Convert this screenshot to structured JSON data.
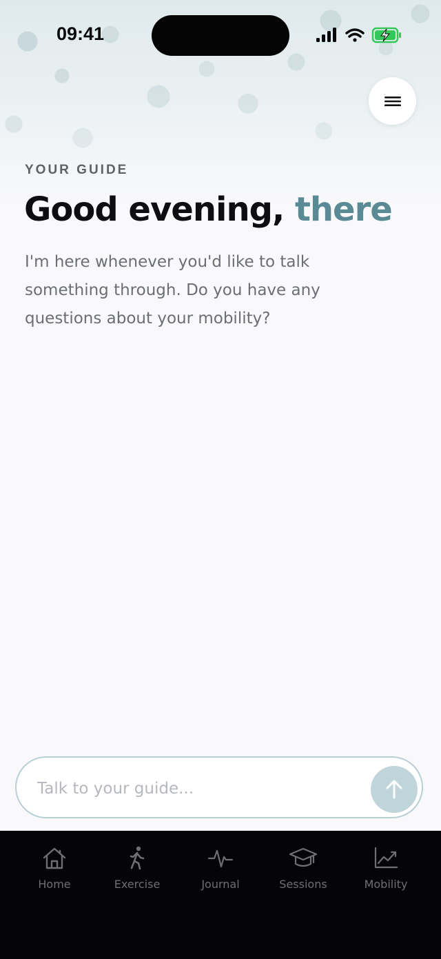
{
  "status_bar": {
    "time": "09:41",
    "icons": [
      "signal-icon",
      "wifi-icon",
      "battery-charging-icon"
    ]
  },
  "header": {
    "menu_icon": "menu-icon"
  },
  "greeting": {
    "eyebrow": "YOUR GUIDE",
    "headline_main": "Good evening,",
    "headline_accent": "there",
    "intro": "I'm here whenever you'd like to talk something through. Do you have any questions about your mobility?"
  },
  "composer": {
    "placeholder": "Talk to your guide...",
    "value": "",
    "send_icon": "arrow-up-icon"
  },
  "tabbar": {
    "items": [
      {
        "label": "Home",
        "icon": "home-icon"
      },
      {
        "label": "Exercise",
        "icon": "walking-icon"
      },
      {
        "label": "Journal",
        "icon": "pulse-icon"
      },
      {
        "label": "Sessions",
        "icon": "graduation-cap-icon"
      },
      {
        "label": "Mobility",
        "icon": "chart-line-icon"
      }
    ]
  },
  "colors": {
    "accent": "#5a8a94",
    "send_button": "#bfd5da",
    "input_border": "#b8d0d4",
    "tabbar_bg": "#050507",
    "battery_green": "#34c759"
  }
}
